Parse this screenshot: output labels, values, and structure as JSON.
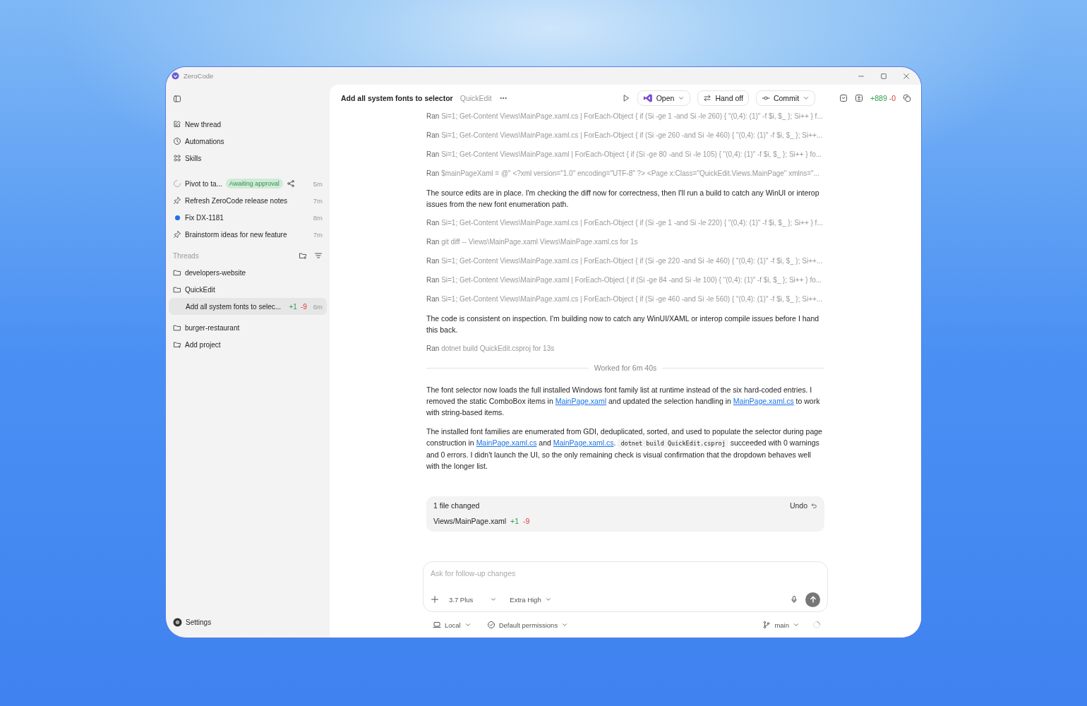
{
  "window": {
    "title": "ZeroCode"
  },
  "sidebar": {
    "nav": [
      {
        "kind": "new",
        "label": "New thread"
      },
      {
        "kind": "clock",
        "label": "Automations"
      },
      {
        "kind": "grid",
        "label": "Skills"
      }
    ],
    "recent": [
      {
        "kind": "spinner",
        "label": "Pivot to ta...",
        "badge": "Awaiting approval",
        "time": "5m"
      },
      {
        "kind": "pin",
        "label": "Refresh ZeroCode release notes",
        "time": "7m"
      },
      {
        "kind": "dot",
        "label": "Fix DX-1181",
        "time": "8m",
        "color": "#1a73e8"
      },
      {
        "kind": "pin",
        "label": "Brainstorm ideas for new feature",
        "time": "7m"
      }
    ],
    "threads_title": "Threads",
    "projects": [
      {
        "label": "developers-website"
      },
      {
        "label": "QuickEdit",
        "children": [
          {
            "label": "Add all system fonts to selec...",
            "added": "+1",
            "removed": "-9",
            "time": "6m",
            "selected": true
          }
        ]
      },
      {
        "label": "burger-restaurant"
      }
    ],
    "add_project": "Add project",
    "settings": "Settings"
  },
  "header": {
    "title": "Add all system fonts to selector",
    "project": "QuickEdit",
    "open": "Open",
    "handoff": "Hand off",
    "commit": "Commit",
    "added": "+889",
    "removed": "-0"
  },
  "log": [
    {
      "kind": "ran",
      "verb": "Ran",
      "command": "Si=1; Get-Content Views\\MainPage.xaml.cs | ForEach-Object { if (Si -ge 1 -and Si -le 260) { \"(0,4): (1)\" -f $i, $_ }; Si++ } f..."
    },
    {
      "kind": "ran",
      "verb": "Ran",
      "command": "Si=1; Get-Content Views\\MainPage.xaml.cs | ForEach-Object { if (Si -ge 260 -and Si -le 460) { \"(0,4): (1)\" -f $i, $_ }; Si++..."
    },
    {
      "kind": "ran",
      "verb": "Ran",
      "command": "Si=1; Get-Content Views\\MainPage.xaml | ForEach-Object { if (Si -ge 80 -and Si -le 105) { \"(0,4): (1)\" -f $i, $_ }; Si++ } fo..."
    },
    {
      "kind": "ran",
      "verb": "Ran",
      "command": "$mainPageXaml = @\" <?xml version=\"1.0\" encoding=\"UTF-8\" ?>  <Page x:Class=\"QuickEdit.Views.MainPage\" xmlns=\"..."
    },
    {
      "kind": "message",
      "parts": [
        {
          "kind": "text",
          "text": "The source edits are in place. I'm checking the diff now for correctness, then I'll run a build to catch any WinUI or interop issues from the new font enumeration path."
        }
      ]
    },
    {
      "kind": "ran",
      "verb": "Ran",
      "command": "Si=1; Get-Content Views\\MainPage.xaml.cs | ForEach-Object { if (Si -ge 1 -and Si -le 220) { \"(0,4): (1)\" -f $i, $_ }; Si++ } f..."
    },
    {
      "kind": "ran",
      "verb": "Ran",
      "command": "git diff -- Views\\MainPage.xaml Views\\MainPage.xaml.cs for 1s"
    },
    {
      "kind": "ran",
      "verb": "Ran",
      "command": "Si=1; Get-Content Views\\MainPage.xaml.cs | ForEach-Object { if (Si -ge 220 -and Si -le 460) { \"(0,4): (1)\" -f $i, $_ }; Si++..."
    },
    {
      "kind": "ran",
      "verb": "Ran",
      "command": "Si=1; Get-Content Views\\MainPage.xaml | ForEach-Object { if (Si -ge 84 -and Si -le 100) { \"(0,4): (1)\" -f $i, $_ }; Si++ } fo..."
    },
    {
      "kind": "ran",
      "verb": "Ran",
      "command": "Si=1; Get-Content Views\\MainPage.xaml.cs | ForEach-Object { if (Si -ge 460 -and Si -le 560) { \"(0,4): (1)\" -f $i, $_ }; Si++..."
    },
    {
      "kind": "message",
      "parts": [
        {
          "kind": "text",
          "text": "The code is consistent on inspection. I'm building now to catch any WinUI/XAML or interop compile issues before I hand this back."
        }
      ]
    },
    {
      "kind": "ran",
      "verb": "Ran",
      "command": "dotnet build QuickEdit.csproj for 13s"
    },
    {
      "kind": "divider",
      "text": "Worked for 6m 40s"
    },
    {
      "kind": "message",
      "parts": [
        {
          "kind": "text",
          "text": "The font selector now loads the full installed Windows font family list at runtime instead of the six hard-coded entries. I removed the static ComboBox items in "
        },
        {
          "kind": "link",
          "text": "MainPage.xaml"
        },
        {
          "kind": "text",
          "text": " and updated the selection handling in "
        },
        {
          "kind": "link",
          "text": "MainPage.xaml.cs"
        },
        {
          "kind": "text",
          "text": " to work with string-based items."
        }
      ]
    },
    {
      "kind": "message",
      "parts": [
        {
          "kind": "text",
          "text": "The installed font families are enumerated from GDI, deduplicated, sorted, and used to populate the selector during page construction in "
        },
        {
          "kind": "link",
          "text": "MainPage.xaml.cs"
        },
        {
          "kind": "text",
          "text": " and "
        },
        {
          "kind": "link",
          "text": "MainPage.xaml.cs"
        },
        {
          "kind": "text",
          "text": ". "
        },
        {
          "kind": "code",
          "text": "dotnet build QuickEdit.csproj"
        },
        {
          "kind": "text",
          "text": " succeeded with 0 warnings and 0 errors. I didn't launch the UI, so the only remaining check is visual confirmation that the dropdown behaves well with the longer list."
        }
      ]
    }
  ],
  "changes": {
    "title": "1 file changed",
    "undo": "Undo",
    "files": [
      {
        "path": "Views/MainPage.xaml",
        "added": "+1",
        "removed": "-9"
      }
    ]
  },
  "composer": {
    "placeholder": "Ask for follow-up changes",
    "model": "3.7 Plus",
    "effort": "Extra High"
  },
  "footer": {
    "location": "Local",
    "permissions": "Default permissions",
    "branch": "main"
  }
}
